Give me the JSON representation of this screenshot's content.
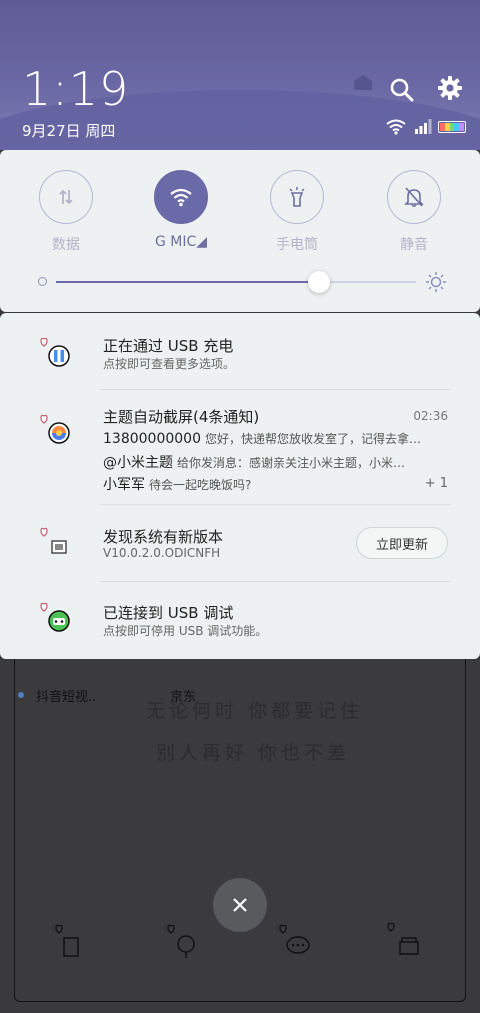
{
  "status": {
    "time": "1:19",
    "date": "9月27日 周四",
    "colors": {
      "header_top": "#5f5c96",
      "accent": "#6b6aa8"
    }
  },
  "header_icons": [
    "search-icon",
    "gear-icon",
    "wifi-icon",
    "signal-icon",
    "battery-icon"
  ],
  "quick_settings": {
    "tiles": [
      {
        "label": "数据",
        "icon": "data-arrows-icon",
        "active": false
      },
      {
        "label": "G   MIC◢",
        "icon": "wifi-icon",
        "active": true
      },
      {
        "label": "手电筒",
        "icon": "flashlight-icon",
        "active": false
      },
      {
        "label": "静音",
        "icon": "bell-off-icon",
        "active": false
      }
    ],
    "brightness": 0.73
  },
  "notifications": [
    {
      "title": "正在通过 USB 充电",
      "subtitle": "点按即可查看更多选项。",
      "icon": "usb-charge-icon"
    },
    {
      "title": "主题自动截屏(4条通知)",
      "time": "02:36",
      "icon": "theme-app-icon",
      "lines": [
        {
          "sender": "13800000000",
          "text": "您好，快递帮您放收发室了，记得去拿…"
        },
        {
          "sender": "@小米主题",
          "text": "给你发消息：感谢亲关注小米主题，小米…"
        },
        {
          "sender": "小军军",
          "text": "待会一起吃晚饭吗?"
        }
      ],
      "more": "+ 1"
    },
    {
      "title": "发现系统有新版本",
      "subtitle": "V10.0.2.0.ODICNFH",
      "button": "立即更新",
      "icon": "updater-icon"
    },
    {
      "title": "已连接到 USB 调试",
      "subtitle": "点按即可停用 USB 调试功能。",
      "icon": "android-debug-icon"
    }
  ],
  "background_app": {
    "labels": [
      "抖音短视..",
      "京东"
    ],
    "poem_lines": [
      "无论何时 你都要记住",
      "别人再好 你也不差"
    ]
  },
  "close_button": "close-icon"
}
